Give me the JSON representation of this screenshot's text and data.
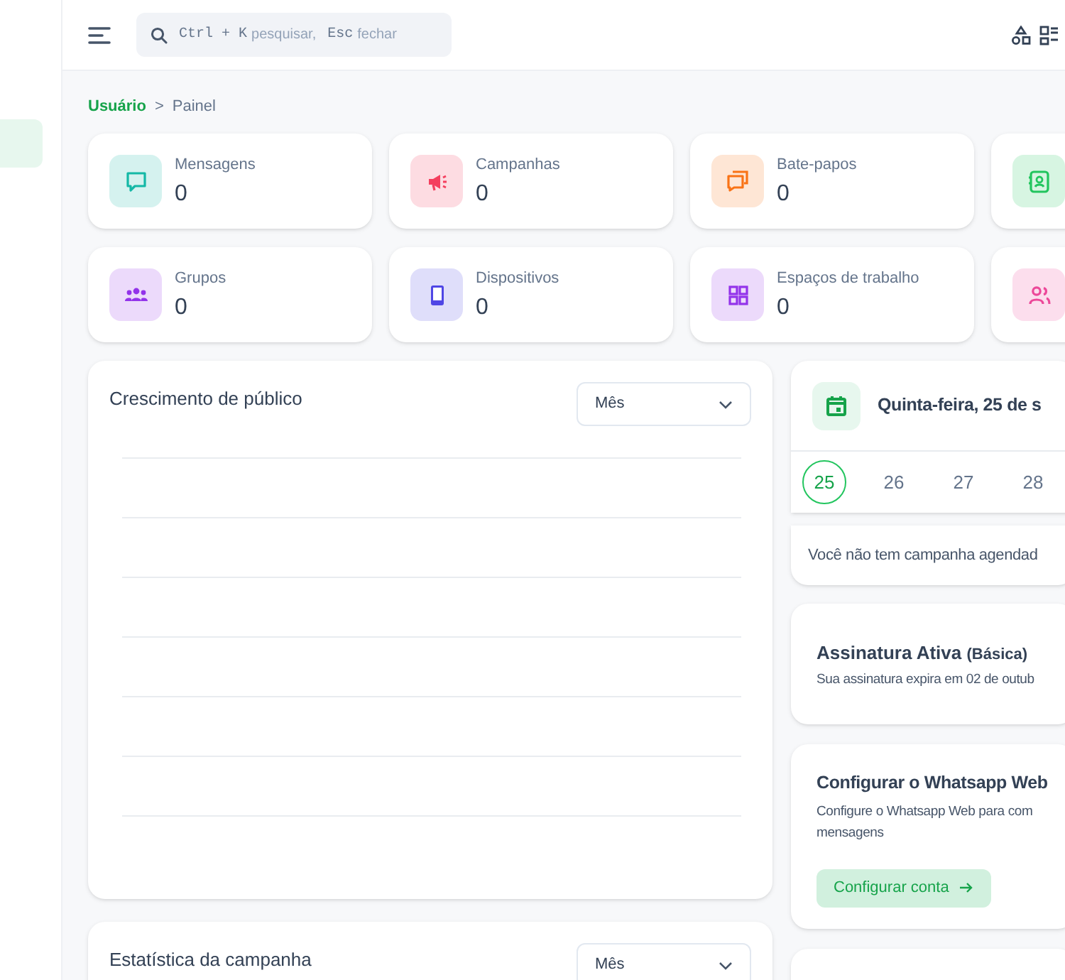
{
  "header": {
    "search": {
      "shortcut_key": "Ctrl + K",
      "placeholder": "pesquisar,",
      "escape_key": "Esc",
      "escape_label": "fechar"
    }
  },
  "sidebar": {
    "items": [
      {
        "selected": true
      }
    ]
  },
  "breadcrumb": [
    {
      "label": "Usuário",
      "kind": "link"
    },
    {
      "label": ">",
      "kind": "separator"
    },
    {
      "label": "Painel",
      "kind": "current"
    }
  ],
  "stats": [
    {
      "label": "Mensagens",
      "value": "0",
      "color": "#14b8a6"
    },
    {
      "label": "Campanhas",
      "value": "0",
      "color": "#f43f5e"
    },
    {
      "label": "Bate-papos",
      "value": "0",
      "color": "#f97316"
    },
    {
      "color": "#22c55e"
    },
    {
      "label": "Grupos",
      "value": "0",
      "color": "#9333ea"
    },
    {
      "label": "Dispositivos",
      "value": "0",
      "color": "#4f46e5"
    },
    {
      "label": "Espaços de trabalho",
      "value": "0",
      "color": "#9333ea"
    },
    {
      "color": "#ec4899"
    }
  ],
  "audience": {
    "title": "Crescimento de público",
    "period": "Mês"
  },
  "campaign_stats": {
    "title": "Estatística da campanha",
    "period": "Mês"
  },
  "calendar": {
    "date_title": "Quinta-feira, 25 de s",
    "days": [
      {
        "label": "25",
        "selected": true
      },
      {
        "label": "26",
        "selected": false
      },
      {
        "label": "27",
        "selected": false
      },
      {
        "label": "28",
        "selected": false
      }
    ],
    "empty_message": "Você não tem campanha agendad"
  },
  "subscription": {
    "title": "Assinatura Ativa",
    "plan": "(Básica)",
    "expiry": "Sua assinatura expira em 02 de outub"
  },
  "whatsapp": {
    "title": "Configurar o Whatsapp Web",
    "description_lines": [
      "Configure o Whatsapp Web para com",
      "mensagens"
    ],
    "button": "Configurar conta"
  }
}
